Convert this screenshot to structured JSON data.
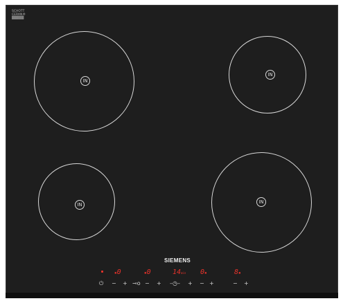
{
  "hob": {
    "brand": "SIEMENS",
    "glass_maker_lines": [
      "SCHOTT",
      "CERAN®",
      "█████"
    ]
  },
  "zones": [
    {
      "label": "IN"
    },
    {
      "label": "IN"
    },
    {
      "label": "IN"
    },
    {
      "label": "IN"
    }
  ],
  "displays": {
    "zone1": "0",
    "zone2": "0",
    "timer": "14",
    "timer_unit": "min",
    "zone3": "0",
    "zone4": "8"
  },
  "controls": {
    "power": "⏻",
    "minus": "−",
    "plus": "+",
    "lock": "⊸o",
    "timer_symbol": "–◷–"
  },
  "colors": {
    "glass": "#1e1e1e",
    "zone_ring": "#d8d8d8",
    "display_red": "#e8332b"
  }
}
